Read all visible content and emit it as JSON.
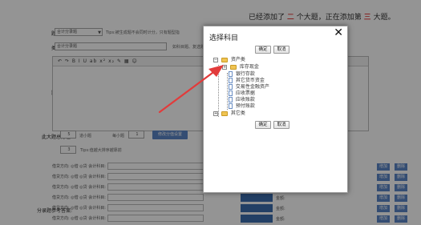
{
  "notice": {
    "prefix": "已经添加了",
    "count1": "二",
    "mid": "个大题，正在添加第",
    "count2": "三",
    "suffix": "大题。"
  },
  "form": {
    "question_type_label": "题目类型:",
    "question_type_value": "合计分录题",
    "question_type_hint": "Tips:被生成题不会同时计分，只有题型指",
    "question_name_label": "类型别名:",
    "question_name_value": "合计分录题",
    "question_name_hint": "如科目题、复选题，会可",
    "stem_label": "题目简介:",
    "editor_toolbar": "↶ ↷  B I U ab x² x₂ ✎ ▦ ☺",
    "score_label": "此大题总分在:",
    "score_value": "5",
    "score_unit": "道小题",
    "each_label": "每小题",
    "each_value": "1",
    "add_btn": "修改分值设置",
    "order_label": "序号:",
    "order_value": "3",
    "order_hint": "Tips:值越大排序越靠前",
    "answer_label": "分录题参考答案:",
    "row_dir": "借贷方向:",
    "row_debit": "◎借",
    "row_credit": "◎贷",
    "row_subject": "会计科目:",
    "row_amount": "金额:",
    "btn_add": "增加",
    "btn_del": "删除"
  },
  "dialog": {
    "title": "选择科目",
    "close_icon": "close-icon",
    "confirm": "确定",
    "cancel": "取消",
    "tree": {
      "root1": "资产类",
      "child_cash": "库存现金",
      "child_bank": "银行存款",
      "child_other_money": "其它货币资金",
      "child_trading": "交易性金融资产",
      "child_notes": "应收票据",
      "child_receivable": "应收账款",
      "child_prepaid": "预付账款",
      "root2": "其它类"
    }
  },
  "colors": {
    "accent": "#5b86c7",
    "notice_red": "#dd0000",
    "folder": "#f0c452",
    "arrow": "#e23b3b"
  }
}
